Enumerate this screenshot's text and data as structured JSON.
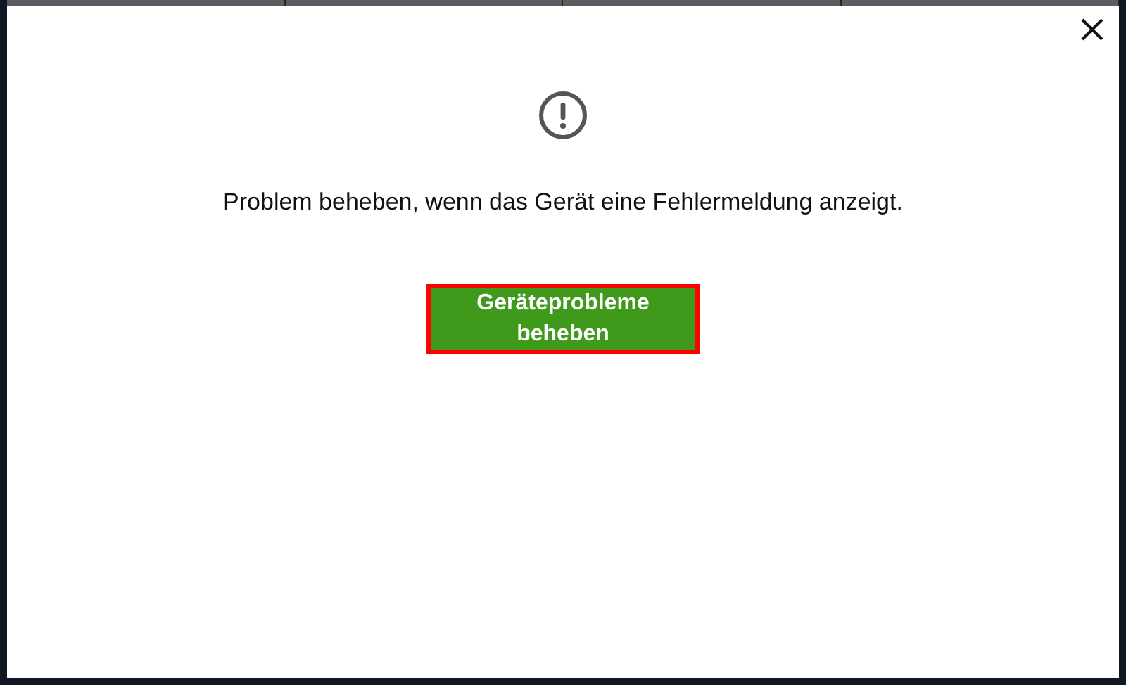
{
  "dialog": {
    "message": "Problem beheben, wenn das Gerät eine Fehlermeldung anzeigt.",
    "button": {
      "label": "Geräteprobleme beheben",
      "highlighted": true
    }
  }
}
